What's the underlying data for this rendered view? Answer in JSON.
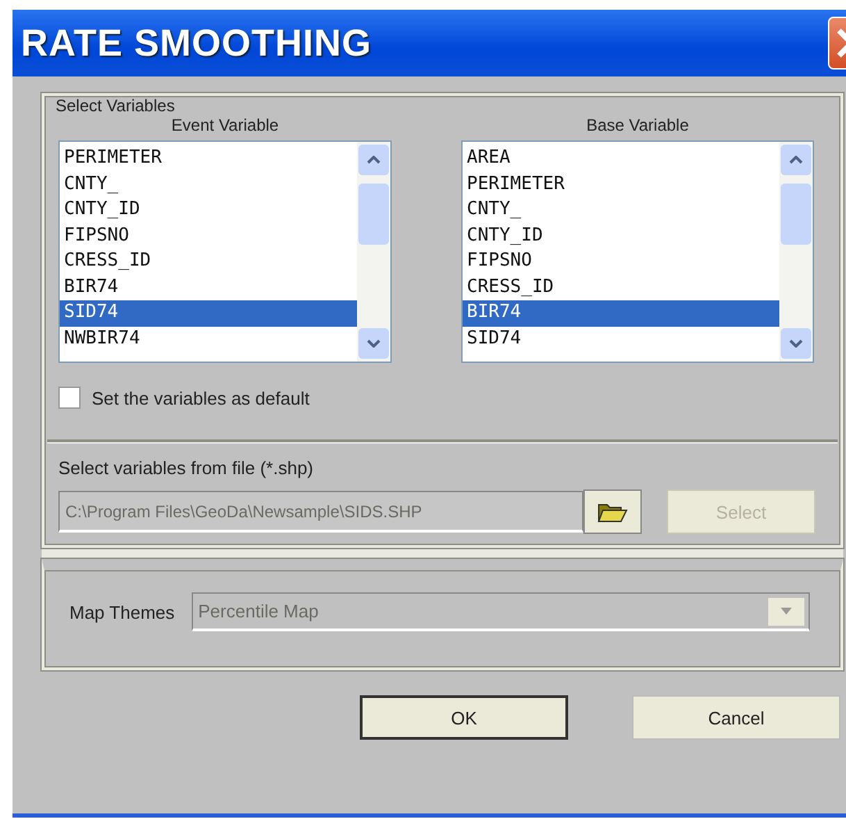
{
  "window": {
    "title": "RATE SMOOTHING"
  },
  "select_variables": {
    "title": "Select Variables",
    "lists": [
      {
        "heading": "Event Variable",
        "items": [
          {
            "label": "PERIMETER",
            "selected": false
          },
          {
            "label": "CNTY_",
            "selected": false
          },
          {
            "label": "CNTY_ID",
            "selected": false
          },
          {
            "label": "FIPSNO",
            "selected": false
          },
          {
            "label": "CRESS_ID",
            "selected": false
          },
          {
            "label": "BIR74",
            "selected": false
          },
          {
            "label": "SID74",
            "selected": true
          },
          {
            "label": "NWBIR74",
            "selected": false
          }
        ]
      },
      {
        "heading": "Base Variable",
        "items": [
          {
            "label": "AREA",
            "selected": false
          },
          {
            "label": "PERIMETER",
            "selected": false
          },
          {
            "label": "CNTY_",
            "selected": false
          },
          {
            "label": "CNTY_ID",
            "selected": false
          },
          {
            "label": "FIPSNO",
            "selected": false
          },
          {
            "label": "CRESS_ID",
            "selected": false
          },
          {
            "label": "BIR74",
            "selected": true
          },
          {
            "label": "SID74",
            "selected": false
          }
        ]
      }
    ],
    "default_checkbox": {
      "label": "Set the variables as default",
      "checked": false
    },
    "file_label": "Select variables  from file (*.shp)",
    "file_path": {
      "value": "C:\\Program Files\\GeoDa\\Newsample\\SIDS.SHP",
      "disabled": true
    },
    "select_button": {
      "label": "Select",
      "disabled": true
    }
  },
  "map_themes": {
    "label": "Map Themes",
    "value": "Percentile Map",
    "disabled": true
  },
  "buttons": [
    {
      "label": "OK",
      "default": true
    },
    {
      "label": "Cancel",
      "default": false
    }
  ]
}
